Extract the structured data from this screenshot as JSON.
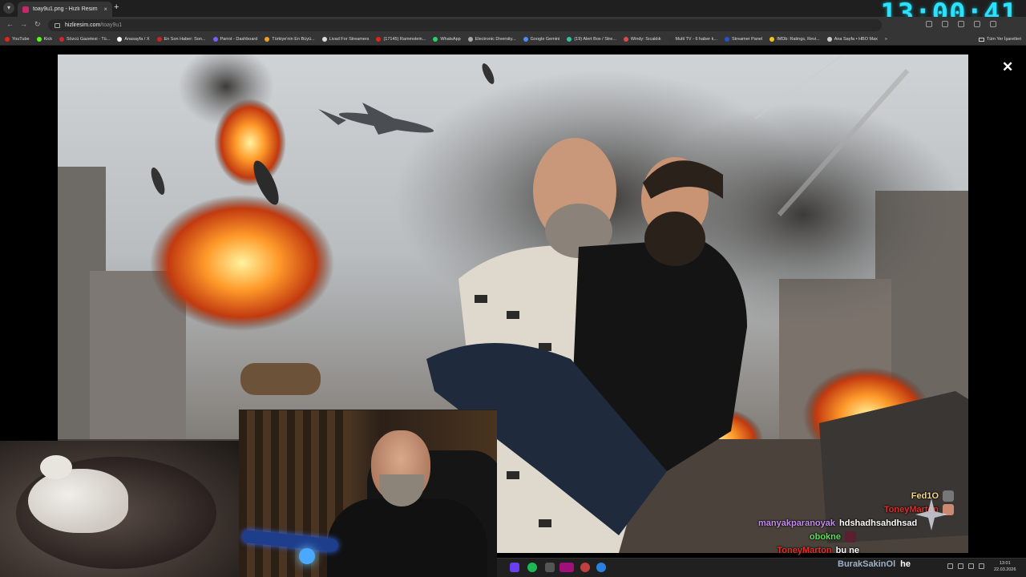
{
  "browser": {
    "tab": {
      "title": "toay9u1.png - Hızlı Resim",
      "close": "×"
    },
    "new_tab": "+",
    "url": {
      "host": "hizliresim.com",
      "path": "/toay9u1"
    },
    "bookmarks": [
      {
        "label": "YouTube",
        "color": "#e62117"
      },
      {
        "label": "Kick",
        "color": "#53fc18"
      },
      {
        "label": "Sözcü Gazetesi - Tü...",
        "color": "#d9232d"
      },
      {
        "label": "Anasayfa / X",
        "color": "#ffffff"
      },
      {
        "label": "En Son Haber: Son...",
        "color": "#c22"
      },
      {
        "label": "Parrot - Dashboard",
        "color": "#7a5cff"
      },
      {
        "label": "Türkiye'nin En Büyü...",
        "color": "#f0a020"
      },
      {
        "label": "Livad For Streamers",
        "color": "#ddd"
      },
      {
        "label": "(17145) Rammstein...",
        "color": "#e62117"
      },
      {
        "label": "WhatsApp",
        "color": "#25d366"
      },
      {
        "label": "Electronic Diversity...",
        "color": "#aaa"
      },
      {
        "label": "Google Gemini",
        "color": "#4e8cf5"
      },
      {
        "label": "(19) Alert Box / Stre...",
        "color": "#31c3a2"
      },
      {
        "label": "Windy: Sıcaklık",
        "color": "#e04848"
      },
      {
        "label": "Multi TV - 6 haber k...",
        "color": "#333"
      },
      {
        "label": "Streamer Panel",
        "color": "#2255cc"
      },
      {
        "label": "IMDb: Ratings, Revi...",
        "color": "#f5c518"
      },
      {
        "label": "Ana Sayfa • HBO Max",
        "color": "#ccc"
      }
    ],
    "bookmarks_more": "»",
    "all_bookmarks": "Tüm Yer İşaretleri"
  },
  "overlay": {
    "clock": "13:00:41"
  },
  "viewer": {
    "close": "✕"
  },
  "chat": [
    {
      "user": "Fed1O",
      "color": "#f2d68a",
      "message": ""
    },
    {
      "user": "ToneyMarton",
      "color": "#e0302a",
      "message": ""
    },
    {
      "user": "manyakparanoyak",
      "color": "#c48ef0",
      "message": "hdshadhsahdhsad"
    },
    {
      "user": "obokne",
      "color": "#5ee05a",
      "message": ""
    },
    {
      "user": "ToneyMarton",
      "color": "#e0302a",
      "message": "bu ne"
    }
  ],
  "bottom_chat": {
    "user": "BurakSakinOl",
    "message": "he"
  },
  "system": {
    "time": "13:01",
    "date": "22.03.2026"
  }
}
